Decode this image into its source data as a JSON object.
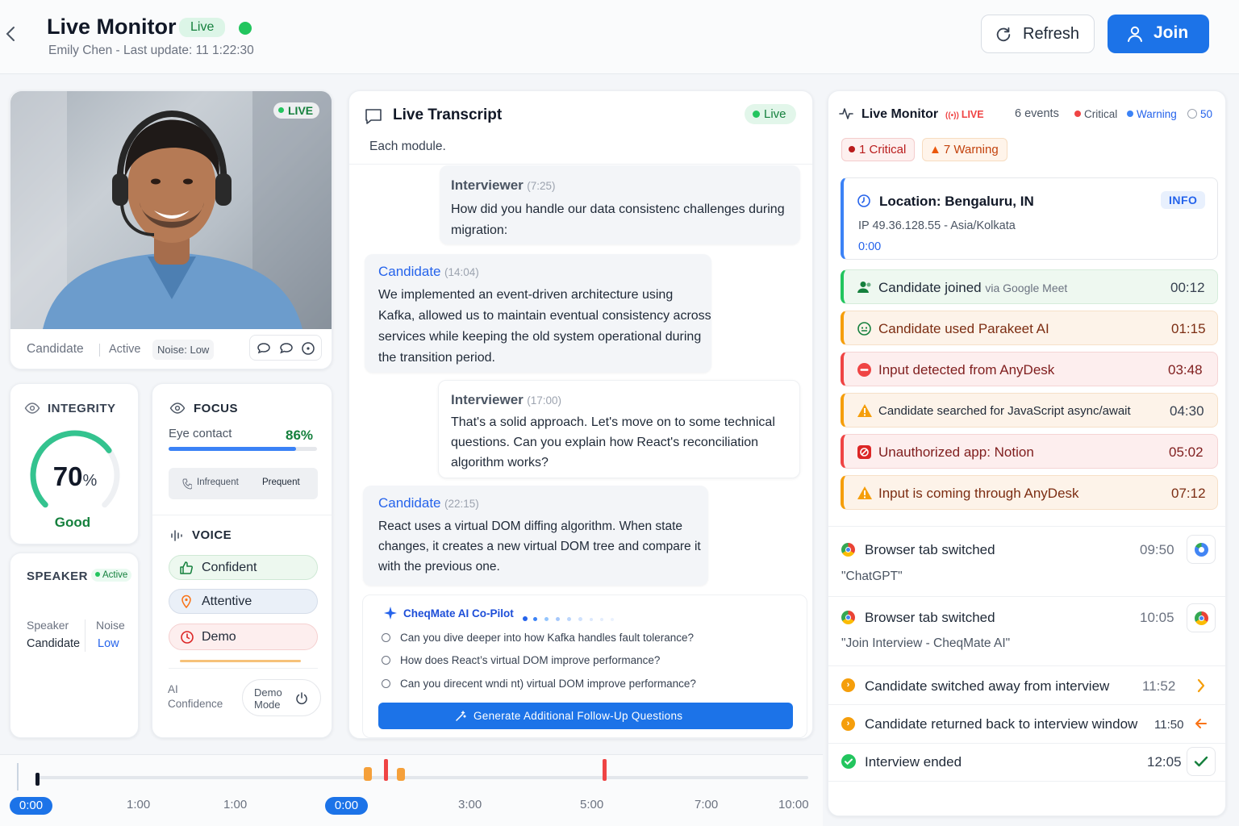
{
  "header": {
    "title": "Live Monitor",
    "live_badge": "Live",
    "subtitle": "Emily Chen - Last update: 11 1:22:30",
    "refresh_label": "Refresh",
    "join_label": "Join"
  },
  "video": {
    "live_badge": "LIVE",
    "role": "Candidate",
    "status": "Active",
    "noise": "Noise: Low"
  },
  "integrity": {
    "title": "INTEGRITY",
    "score": "70",
    "unit": "%",
    "score_value": 0.7,
    "rating": "Good"
  },
  "speaker": {
    "title": "SPEAKER",
    "badge": "Active",
    "col1_label": "Speaker",
    "col1_value": "Candidate",
    "col2_label": "Noise",
    "col2_value": "Low"
  },
  "focus": {
    "title": "FOCUS",
    "eye_label": "Eye contact",
    "eye_value": "86%",
    "eye_fraction": 0.86,
    "toggle_left": "Infrequent",
    "toggle_right": "Prequent"
  },
  "voice": {
    "title": "VOICE",
    "tags": [
      "Confident",
      "Attentive",
      "Demo"
    ],
    "ai_label_1": "AI",
    "ai_label_2": "Confidence",
    "demo_1": "Demo",
    "demo_2": "Mode"
  },
  "transcript": {
    "title": "Live Transcript",
    "live_badge": "Live",
    "intro": "Each module.",
    "messages": [
      {
        "speaker": "Interviewer",
        "time": "(7:25)",
        "text": "How did you handle our data consistenc challenges during migration:"
      },
      {
        "speaker": "Candidate",
        "time": "(14:04)",
        "text": "We implemented an event-driven architecture using Kafka, allowed us to maintain eventual consistency across services while keeping the old system operational during the transition period."
      },
      {
        "speaker": "Interviewer",
        "time": "(17:00)",
        "text": "That's a solid approach. Let's move on to some technical questions. Can you explain how React's reconciliation algorithm works?"
      },
      {
        "speaker": "Candidate",
        "time": "(22:15)",
        "text": "React uses a virtual DOM diffing algorithm. When state changes, it creates a new virtual DOM tree and compare it with the previous one."
      }
    ],
    "copilot_title": "CheqMate AI Co-Pilot",
    "suggestions": [
      "Can you dive deeper into how Kafka handles fault tolerance?",
      "How does React’s virtual DOM improve performance?",
      "Can you direcent wndi nt) virtual DOM improve performance?"
    ],
    "generate_label": "Generate Additional Follow-Up Questions"
  },
  "monitor": {
    "title": "Live Monitor",
    "live_badge": "LIVE",
    "events_count": "6 events",
    "critical_legend": "Critical",
    "warning_legend": "Warning",
    "count_badge": "50",
    "critical_chip": "1 Critical",
    "warning_chip": "7 Warning",
    "location": {
      "title": "Location: Bengaluru, IN",
      "badge": "INFO",
      "ip": "IP 49.36.128.55 - Asia/Kolkata",
      "time": "0:00"
    },
    "events": [
      {
        "title": "Candidate joined",
        "via": "via Google Meet",
        "time": "00:12"
      },
      {
        "title": "Candidate used Parakeet AI",
        "time": "01:15"
      },
      {
        "title": "Input detected from AnyDesk",
        "time": "03:48"
      },
      {
        "title": "Candidate searched for JavaScript async/await",
        "time": "04:30"
      },
      {
        "title": "Unauthorized app: Notion",
        "time": "05:02"
      },
      {
        "title": "Input is coming through AnyDesk",
        "time": "07:12"
      }
    ],
    "tabs": [
      {
        "title": "Browser tab switched",
        "time": "09:50",
        "detail": "\"ChatGPT\""
      },
      {
        "title": "Browser tab switched",
        "time": "10:05",
        "detail": "\"Join Interview - CheqMate AI\""
      }
    ],
    "focus_events": [
      {
        "title": "Candidate switched away from interview",
        "time": "11:52"
      },
      {
        "title": "Candidate returned back to interview window",
        "time": "11:50"
      },
      {
        "title": "Interview ended",
        "time": "12:05"
      }
    ]
  },
  "timeline": {
    "current_start": "0:00",
    "current_mid": "0:00",
    "ticks": [
      "1:00",
      "1:00",
      "3:00",
      "5:00",
      "7:00",
      "10:00"
    ]
  },
  "colors": {
    "primary": "#1c73e8",
    "live_green": "#22c55e",
    "critical": "#ef4444",
    "warning": "#f59e0b",
    "candidate_blue": "#2563eb"
  }
}
